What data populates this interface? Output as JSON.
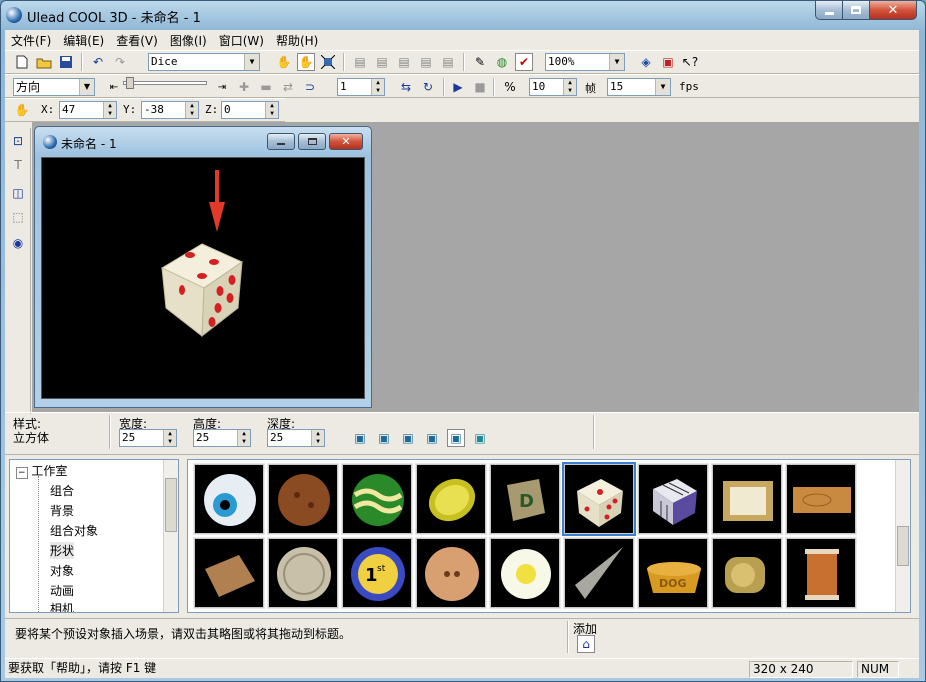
{
  "window": {
    "title": "Ulead COOL 3D - 未命名 - 1",
    "minimize": "0",
    "maximize": "1",
    "close": "r"
  },
  "menu": [
    "文件(F)",
    "编辑(E)",
    "查看(V)",
    "图像(I)",
    "窗口(W)",
    "帮助(H)"
  ],
  "toolbar1": {
    "object_select": "Dice",
    "zoom": "100%"
  },
  "toolbar2": {
    "mode_select": "方向",
    "frame": "1",
    "frames": "10",
    "frames_label": "帧",
    "fps": "15",
    "fps_label": "fps"
  },
  "toolbar3": {
    "x_label": "X:",
    "x_value": "47",
    "y_label": "Y:",
    "y_value": "-38",
    "z_label": "Z:",
    "z_value": "0"
  },
  "child": {
    "title": "未命名 - 1"
  },
  "props": {
    "style_label": "样式:",
    "style_value": "立方体",
    "width_label": "宽度:",
    "width_value": "25",
    "height_label": "高度:",
    "height_value": "25",
    "depth_label": "深度:",
    "depth_value": "25"
  },
  "tree": {
    "root": "工作室",
    "items": [
      "组合",
      "背景",
      "组合对象",
      "形状",
      "对象",
      "动画",
      "相机"
    ]
  },
  "hint": {
    "text": "要将某个预设对象插入场景，请双击其略图或将其拖动到标题。",
    "add_label": "添加"
  },
  "status": {
    "help": "要获取「帮助」，请按 F1 键",
    "size": "320 x 240",
    "num": "NUM"
  },
  "colors": {
    "canvas": "#000000",
    "workspace": "#a6a6a6",
    "arrow": "#e03a2a",
    "dice_face": "#f0ebd8",
    "pip": "#d42020"
  }
}
